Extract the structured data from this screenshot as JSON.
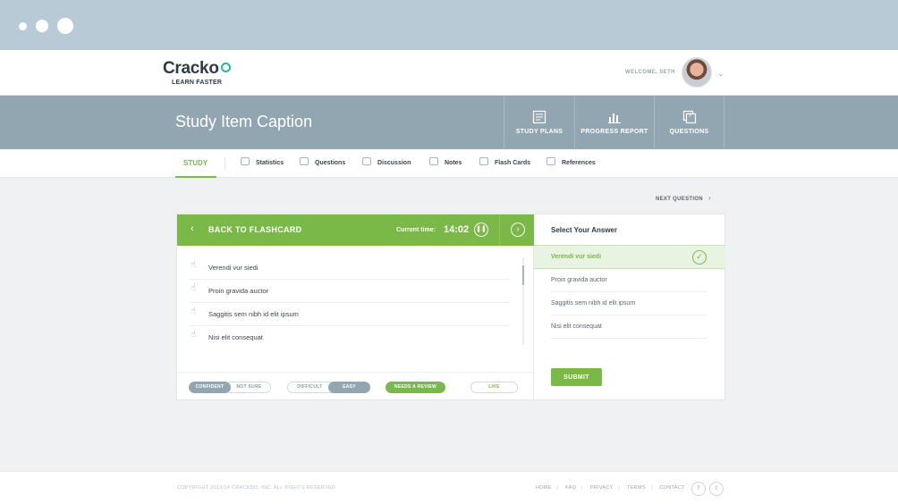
{
  "header": {
    "logo_word": "Cracko",
    "logo_tagline": "LEARN FASTER",
    "welcome": "WELCOME, SETH",
    "chevron": "⌄"
  },
  "band": {
    "title": "Study Item Caption",
    "buttons": [
      {
        "label": "STUDY PLANS",
        "icon": "study-plans-icon"
      },
      {
        "label": "PROGRESS REPORT",
        "icon": "bar-chart-icon"
      },
      {
        "label": "QUESTIONS",
        "icon": "questions-icon"
      }
    ]
  },
  "tabs": {
    "active": "STUDY",
    "items": [
      {
        "label": "Statistics",
        "icon": "statistics-icon"
      },
      {
        "label": "Questions",
        "icon": "questions-icon"
      },
      {
        "label": "Discussion",
        "icon": "discussion-icon"
      },
      {
        "label": "Notes",
        "icon": "notes-icon"
      },
      {
        "label": "Flash Cards",
        "icon": "flash-cards-icon"
      },
      {
        "label": "References",
        "icon": "references-icon"
      }
    ]
  },
  "next_question": "NEXT QUESTION",
  "card": {
    "back_label": "BACK TO FLASHCARD",
    "current_time_label": "Current time:",
    "current_time": "14:02",
    "options": [
      "Verendi vur siedi",
      "Proin gravida auctor",
      "Saggitis sem nibh id elit ipsum",
      "Nisi elit consequat"
    ],
    "footer": {
      "confident": "CONFIDENT",
      "not_sure": "NOT SURE",
      "difficult": "DIFFICULT",
      "easy": "EASY",
      "needs_review": "NEEDS A REVIEW",
      "like": "LIKE"
    }
  },
  "answer": {
    "title": "Select Your Answer",
    "selected": "Verendi vur siedi",
    "options": [
      "Proin gravida auctor",
      "Saggitis sem nibh id elit ipsum",
      "Nisi elit consequat"
    ],
    "submit": "SUBMIT"
  },
  "footer": {
    "copyright": "COPYRIGHT 2013/14 CRACKDO, INC. ALL RIGHTS RESERVED",
    "links": [
      "HOME",
      "FAQ",
      "PRIVACY",
      "TERMS",
      "CONTACT"
    ],
    "social": [
      "facebook-icon",
      "twitter-icon"
    ]
  },
  "colors": {
    "accent_green": "#7ab848",
    "band_grey": "#92a6b1",
    "chrome": "#b7cad5",
    "logo_teal": "#20b79f"
  }
}
